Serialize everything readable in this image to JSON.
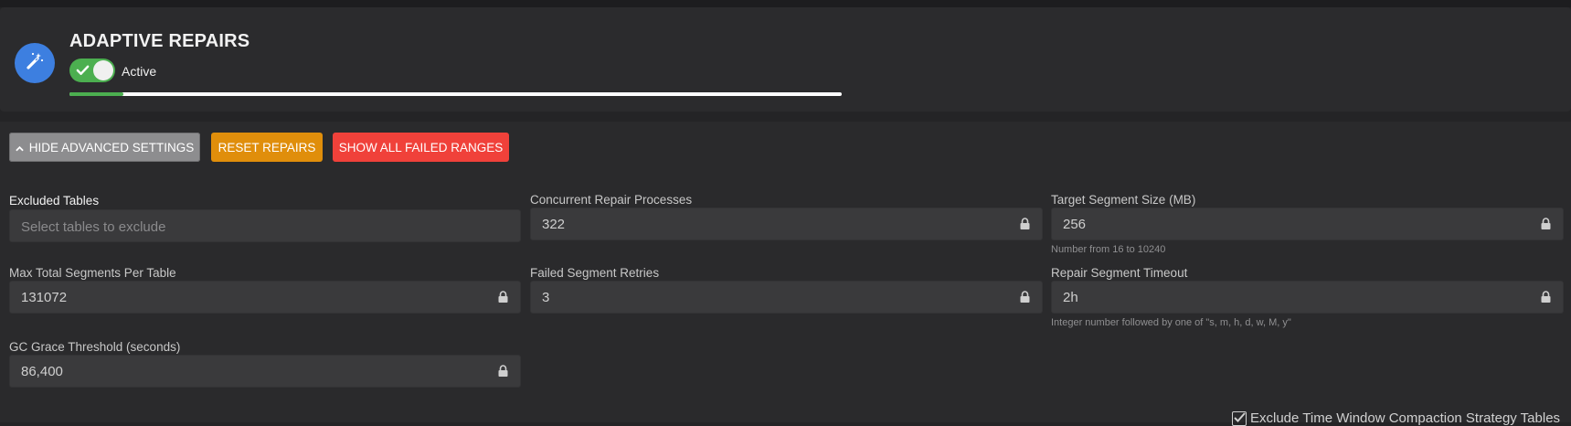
{
  "header": {
    "title": "ADAPTIVE REPAIRS",
    "status_label": "Active",
    "toggle_on": true,
    "progress_percent": 7,
    "accent_color": "#4caf50",
    "logo_color": "#3d7fe0",
    "logo_icon": "magic-wand-icon"
  },
  "buttons": {
    "hide_advanced": "HIDE ADVANCED SETTINGS",
    "reset_repairs": "RESET REPAIRS",
    "show_failed": "SHOW ALL FAILED RANGES"
  },
  "fields": {
    "excluded_tables": {
      "label": "Excluded Tables",
      "placeholder": "Select tables to exclude"
    },
    "concurrent_processes": {
      "label": "Concurrent Repair Processes",
      "value": "322"
    },
    "target_segment_size": {
      "label": "Target Segment Size (MB)",
      "value": "256",
      "hint": "Number from 16 to 10240"
    },
    "max_total_segments": {
      "label": "Max Total Segments Per Table",
      "value": "131072"
    },
    "failed_retries": {
      "label": "Failed Segment Retries",
      "value": "3"
    },
    "repair_timeout": {
      "label": "Repair Segment Timeout",
      "value": "2h",
      "hint": "Integer number followed by one of \"s, m, h, d, w, M, y\""
    },
    "gc_grace": {
      "label": "GC Grace Threshold (seconds)",
      "value": "86,400"
    }
  },
  "exclude_twcs": {
    "label": "Exclude Time Window Compaction Strategy Tables",
    "checked": true
  }
}
